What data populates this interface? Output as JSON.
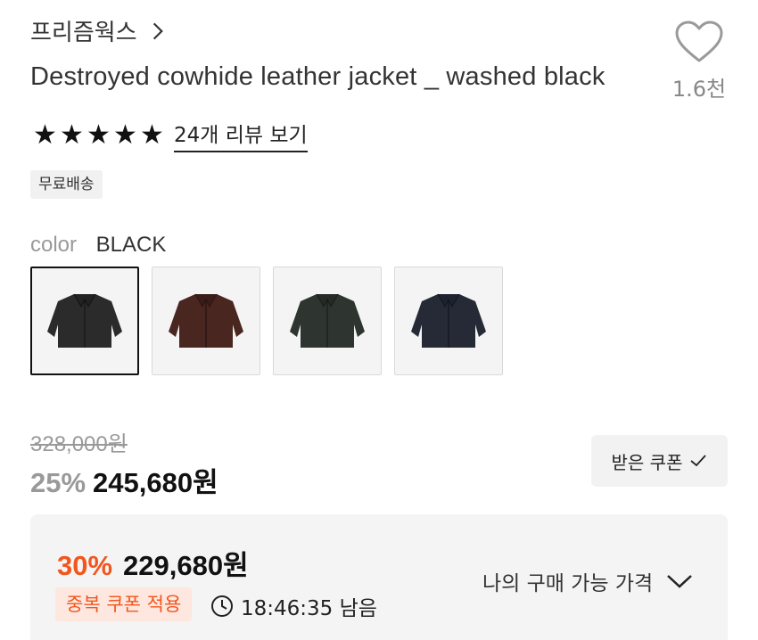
{
  "brand": {
    "name": "프리즘웍스"
  },
  "product": {
    "title": "Destroyed cowhide leather jacket _ washed black"
  },
  "wishlist": {
    "count": "1.6천"
  },
  "rating": {
    "stars": 5,
    "review_link": "24개 리뷰 보기"
  },
  "badges": {
    "shipping": "무료배송"
  },
  "color": {
    "label": "color",
    "selected": "BLACK",
    "options": [
      {
        "name": "black",
        "fill": "#2b2b2b"
      },
      {
        "name": "brown",
        "fill": "#4a2620"
      },
      {
        "name": "dark-green",
        "fill": "#2e342f"
      },
      {
        "name": "navy",
        "fill": "#262a36"
      }
    ]
  },
  "price": {
    "original": "328,000원",
    "discount": "25%",
    "sale": "245,680원"
  },
  "coupon": {
    "label": "받은 쿠폰"
  },
  "benefit": {
    "discount": "30%",
    "price": "229,680원",
    "dup_coupon": "중복 쿠폰 적용",
    "timer": "18:46:35 남음",
    "my_price_label": "나의 구매 가능 가격"
  },
  "colors": {
    "accent": "#f2561d",
    "accent_bg": "#fde7df"
  }
}
